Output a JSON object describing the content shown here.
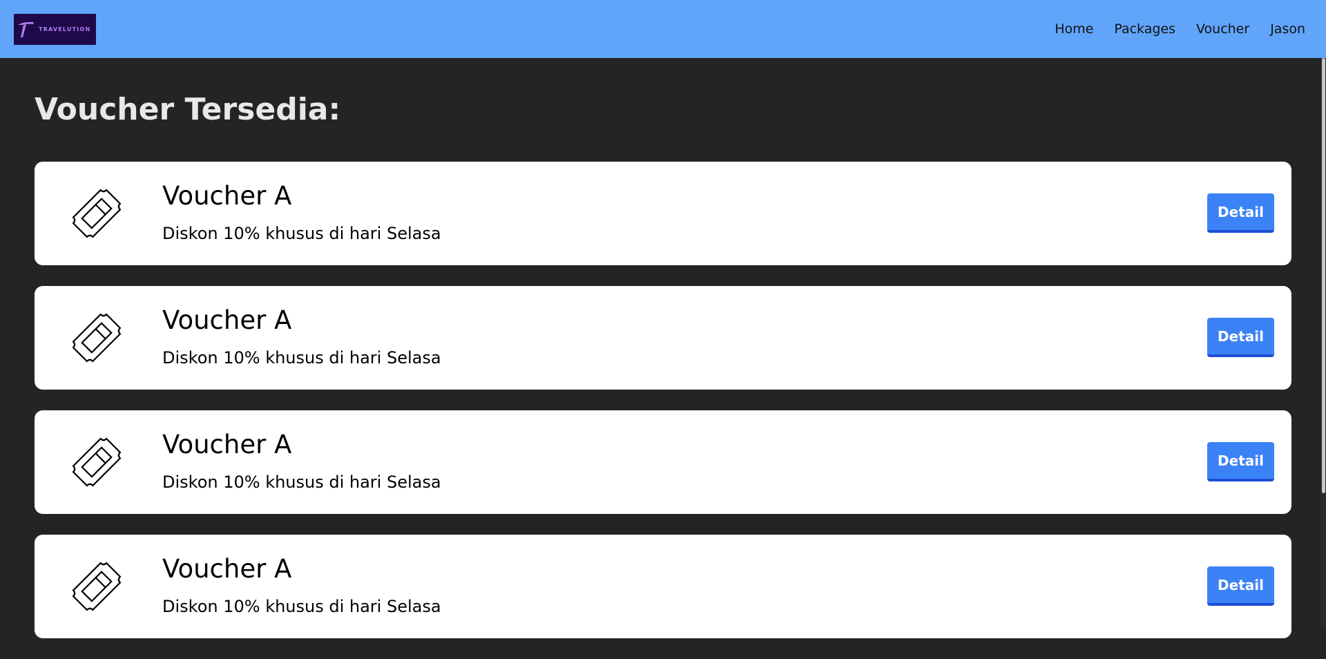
{
  "brand": {
    "logo_text": "TRAVELUTION",
    "logo_colors": {
      "bg": "#1e0a4a",
      "mark": "#b27cf0"
    }
  },
  "nav": {
    "links": [
      "Home",
      "Packages",
      "Voucher",
      "Jason"
    ]
  },
  "page": {
    "title": "Voucher Tersedia:"
  },
  "vouchers": [
    {
      "title": "Voucher A",
      "description": "Diskon 10% khusus di hari Selasa",
      "button": "Detail",
      "icon": "ticket-icon"
    },
    {
      "title": "Voucher A",
      "description": "Diskon 10% khusus di hari Selasa",
      "button": "Detail",
      "icon": "ticket-icon"
    },
    {
      "title": "Voucher A",
      "description": "Diskon 10% khusus di hari Selasa",
      "button": "Detail",
      "icon": "ticket-icon"
    },
    {
      "title": "Voucher A",
      "description": "Diskon 10% khusus di hari Selasa",
      "button": "Detail",
      "icon": "ticket-icon"
    }
  ],
  "colors": {
    "nav_bg": "#60a5fa",
    "page_bg": "#242424",
    "button": "#3b82f6"
  }
}
